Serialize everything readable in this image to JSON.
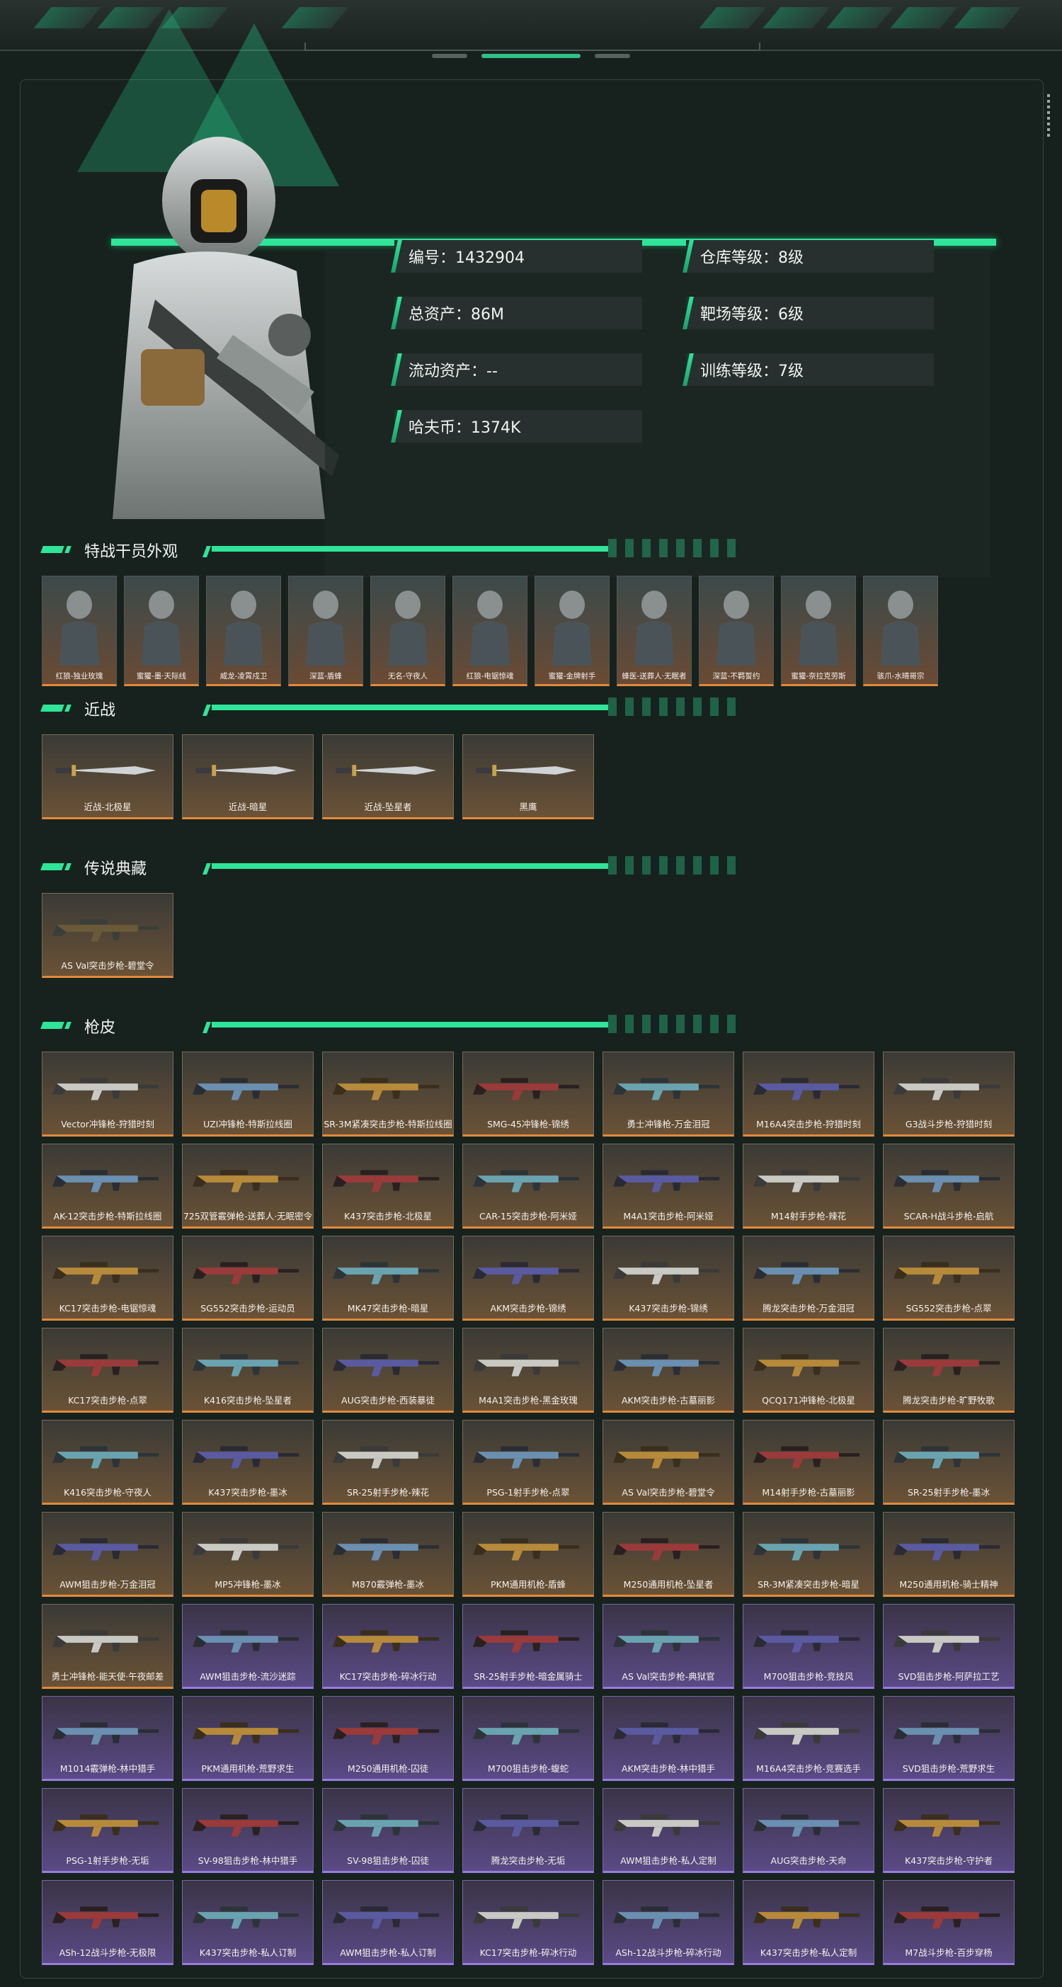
{
  "profile": {
    "id": "编号：1432904",
    "total_assets": "总资产：86M",
    "liquid_assets": "流动资产：--",
    "havcoin": "哈夫币：1374K",
    "warehouse": "仓库等级：8级",
    "range": "靶场等级：6级",
    "training": "训练等级：7级"
  },
  "sections": {
    "operators": "特战干员外观",
    "melee": "近战",
    "legend": "传说典藏",
    "skins": "枪皮"
  },
  "operators": [
    "红狼-独业玫瑰",
    "蜜獾-墨·天际线",
    "威龙-凌霄戍卫",
    "深蓝-盾蜂",
    "无名-守夜人",
    "红狼-电锯惊魂",
    "蜜獾-金牌射手",
    "蜂医-送葬人·无眠者",
    "深蓝-不羁誓约",
    "蜜獾-奈拉克劳斯",
    "骇爪-水晴哥宗"
  ],
  "melee": [
    "近战-北极星",
    "近战-暗星",
    "近战-坠星者",
    "黑鹰"
  ],
  "legend": [
    "AS Val突击步枪-碧堂令"
  ],
  "skins": [
    [
      "Vector冲锋枪-狩猎时刻",
      "UZI冲锋枪-特斯拉线圈",
      "SR-3M紧凑突击步枪-特斯拉线圈",
      "SMG-45冲锋枪-锦绣",
      "勇士冲锋枪-万金泪冠",
      "M16A4突击步枪-狩猎时刻",
      "G3战斗步枪-狩猎时刻"
    ],
    [
      "AK-12突击步枪-特斯拉线圈",
      "725双管霰弹枪-送葬人·无眠密令",
      "K437突击步枪-北极星",
      "CAR-15突击步枪-阿米娅",
      "M4A1突击步枪-阿米娅",
      "M14射手步枪-辣花",
      "SCAR-H战斗步枪-启航"
    ],
    [
      "KC17突击步枪-电锯惊魂",
      "SG552突击步枪-运动员",
      "MK47突击步枪-暗星",
      "AKM突击步枪-锦绣",
      "K437突击步枪-锦绣",
      "腾龙突击步枪-万金泪冠",
      "SG552突击步枪-点翠"
    ],
    [
      "KC17突击步枪-点翠",
      "K416突击步枪-坠星者",
      "AUG突击步枪-西装暴徒",
      "M4A1突击步枪-黑金玫瑰",
      "AKM突击步枪-古墓丽影",
      "QCQ171冲锋枪-北极星",
      "腾龙突击步枪-旷野牧歌"
    ],
    [
      "K416突击步枪-守夜人",
      "K437突击步枪-墨冰",
      "SR-25射手步枪-辣花",
      "PSG-1射手步枪-点翠",
      "AS Val突击步枪-碧堂令",
      "M14射手步枪-古墓丽影",
      "SR-25射手步枪-墨冰"
    ],
    [
      "AWM狙击步枪-万金泪冠",
      "MP5冲锋枪-墨冰",
      "M870霰弹枪-墨冰",
      "PKM通用机枪-盾蜂",
      "M250通用机枪-坠星者",
      "SR-3M紧凑突击步枪-暗星",
      "M250通用机枪-骑士精神"
    ],
    [
      "勇士冲锋枪-能天使·午夜邮差",
      "AWM狙击步枪-流沙迷踪",
      "KC17突击步枪-碎冰行动",
      "SR-25射手步枪-暗金属骑士",
      "AS Val突击步枪-典狱官",
      "M700狙击步枪-竞技风",
      "SVD狙击步枪-阿萨拉工艺"
    ],
    [
      "M1014霰弹枪-林中猎手",
      "PKM通用机枪-荒野求生",
      "M250通用机枪-囚徒",
      "M700狙击步枪-蝮蛇",
      "AKM突击步枪-林中猎手",
      "M16A4突击步枪-竞赛选手",
      "SVD狙击步枪-荒野求生"
    ],
    [
      "PSG-1射手步枪-无垢",
      "SV-98狙击步枪-林中猎手",
      "SV-98狙击步枪-囚徒",
      "腾龙突击步枪-无垢",
      "AWM狙击步枪-私人定制",
      "AUG突击步枪-天命",
      "K437突击步枪-守护者"
    ],
    [
      "ASh-12战斗步枪-无极限",
      "K437突击步枪-私人订制",
      "AWM狙击步枪-私人订制",
      "KC17突击步枪-碎冰行动",
      "ASh-12战斗步枪-碎冰行动",
      "K437突击步枪-私人定制",
      "M7战斗步枪-百步穿杨"
    ]
  ],
  "skin_purple_from_index": 43,
  "colors": {
    "accent": "#2ee59a",
    "gold_edge": "#e08a3c",
    "purple_edge": "#9a7ae0"
  }
}
